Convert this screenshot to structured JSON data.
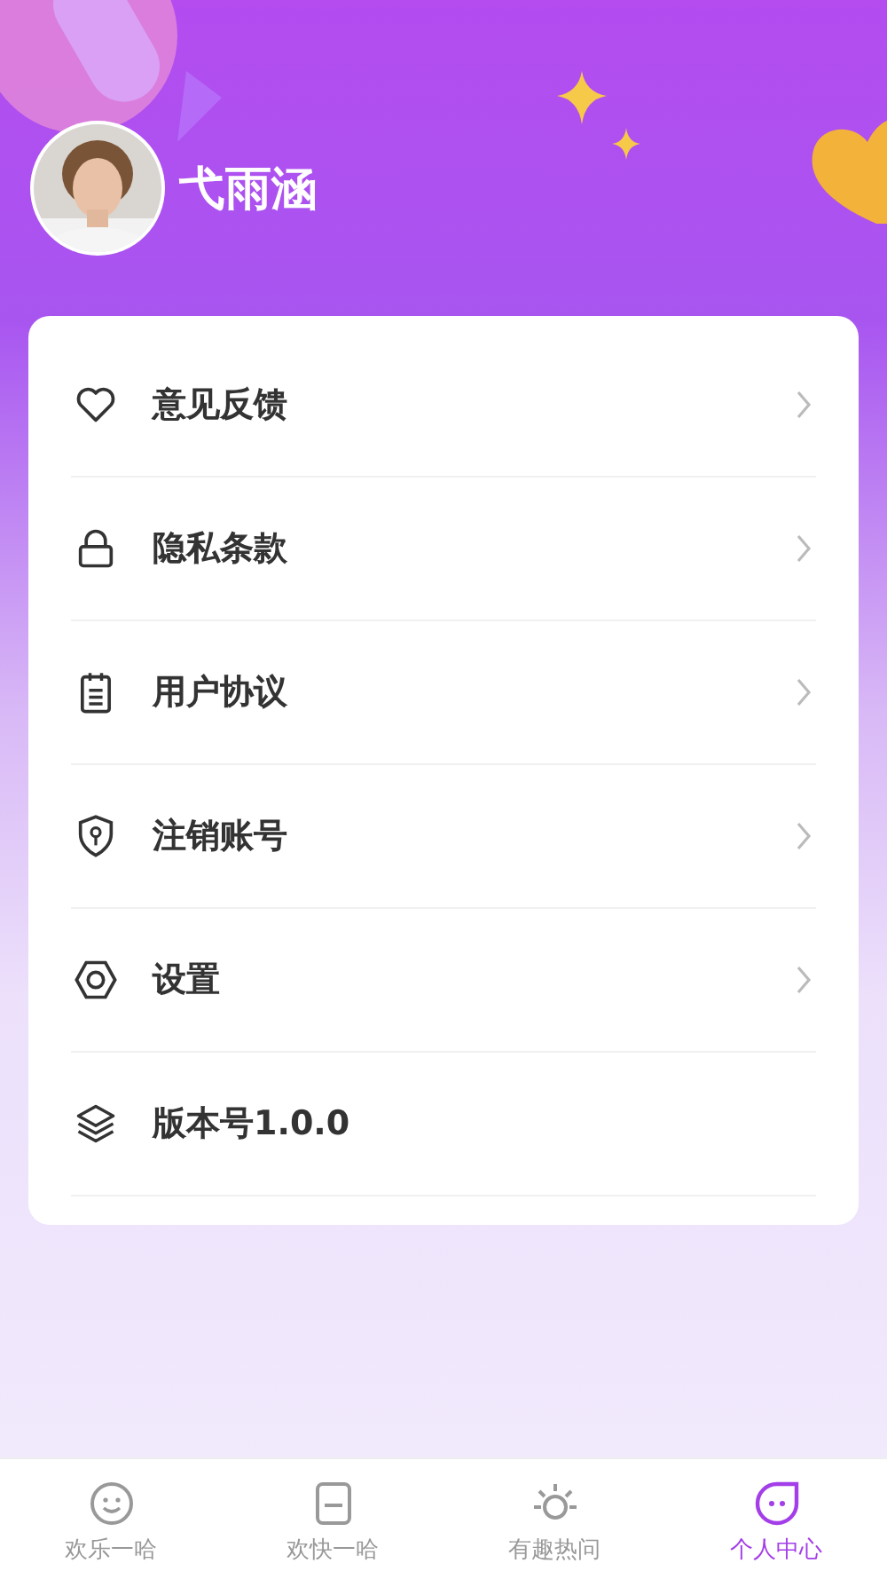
{
  "profile": {
    "name": "弋雨涵"
  },
  "menu": [
    {
      "label": "意见反馈",
      "chevron": true
    },
    {
      "label": "隐私条款",
      "chevron": true
    },
    {
      "label": "用户协议",
      "chevron": true
    },
    {
      "label": "注销账号",
      "chevron": true
    },
    {
      "label": "设置",
      "chevron": true
    },
    {
      "label": "版本号1.0.0",
      "chevron": false
    }
  ],
  "tabs": [
    {
      "label": "欢乐一哈",
      "selected": false
    },
    {
      "label": "欢快一哈",
      "selected": false
    },
    {
      "label": "有趣热问",
      "selected": false
    },
    {
      "label": "个人中心",
      "selected": true
    }
  ]
}
